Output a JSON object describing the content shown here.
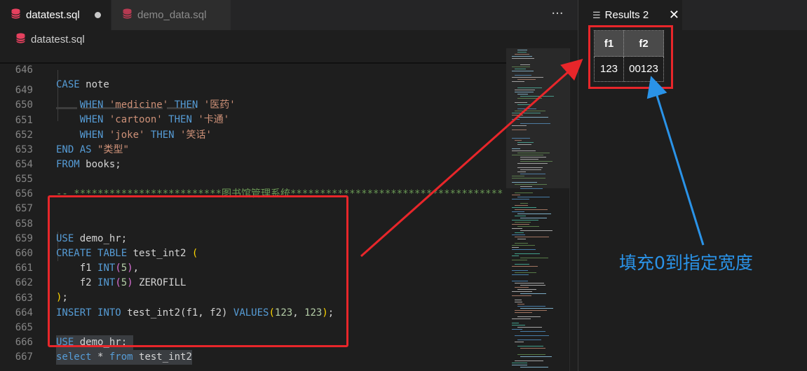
{
  "tabs": [
    {
      "label": "datatest.sql",
      "active": true,
      "modified": true
    },
    {
      "label": "demo_data.sql",
      "active": false
    }
  ],
  "breadcrumb": {
    "file": "datatest.sql"
  },
  "more_actions_icon": "ellipsis-icon",
  "code_lines": [
    {
      "num": "646"
    },
    {
      "num": "649"
    },
    {
      "num": "650"
    },
    {
      "num": "651"
    },
    {
      "num": "652"
    },
    {
      "num": "653"
    },
    {
      "num": "654"
    },
    {
      "num": "655"
    },
    {
      "num": "656"
    },
    {
      "num": "657"
    },
    {
      "num": "658"
    },
    {
      "num": "659"
    },
    {
      "num": "660"
    },
    {
      "num": "661"
    },
    {
      "num": "662"
    },
    {
      "num": "663"
    },
    {
      "num": "664"
    },
    {
      "num": "665"
    },
    {
      "num": "666"
    },
    {
      "num": "667"
    }
  ],
  "code": {
    "l646": {
      "kw": "CASE",
      "rest": " note"
    },
    "l649": {
      "kw1": "WHEN",
      "str1": "'medicine'",
      "kw2": "THEN",
      "str2": "'医药'"
    },
    "l650": {
      "kw1": "WHEN",
      "str1": "'cartoon'",
      "kw2": "THEN",
      "str2": "'卡通'"
    },
    "l651": {
      "kw1": "WHEN",
      "str1": "'joke'",
      "kw2": "THEN",
      "str2": "'笑话'"
    },
    "l652": {
      "kw1": "END",
      "kw2": "AS",
      "str": "\"类型\""
    },
    "l653": {
      "kw": "FROM",
      "rest": " books;"
    },
    "l655": {
      "comment": "-- *************************图书馆管理系统************************************"
    },
    "l658": {
      "kw": "USE",
      "rest": " demo_hr;"
    },
    "l659": {
      "kw1": "CREATE",
      "kw2": "TABLE",
      "rest": " test_int2 ",
      "paren": "("
    },
    "l660": {
      "col": "f1 ",
      "kw": "INT",
      "p1": "(",
      "num": "5",
      "p2": ")",
      "rest": ","
    },
    "l661": {
      "col": "f2 ",
      "kw": "INT",
      "p1": "(",
      "num": "5",
      "p2": ")",
      "rest": " ZEROFILL"
    },
    "l662": {
      "paren": ")",
      "rest": ";"
    },
    "l663": {
      "kw1": "INSERT",
      "kw2": "INTO",
      "mid": " test_int2(f1, f2) ",
      "kw3": "VALUES",
      "p1": "(",
      "n1": "123",
      "sep": ", ",
      "n2": "123",
      "p2": ")",
      "rest": ";"
    },
    "l665": {
      "kw": "USE",
      "rest": " demo_hr;"
    },
    "l666": {
      "kw1": "select",
      "star": " * ",
      "kw2": "from",
      "rest": " test_int2"
    }
  },
  "results_panel": {
    "tab_label": "Results 2",
    "columns": [
      "f1",
      "f2"
    ],
    "rows": [
      [
        "123",
        "00123"
      ]
    ]
  },
  "annotation": {
    "text": "填充0到指定宽度"
  },
  "colors": {
    "highlight_box": "#e8262a",
    "annotation": "#2a93e8",
    "keyword": "#569cd6",
    "string": "#ce9178",
    "number": "#b5cea8",
    "comment": "#6a9955"
  }
}
